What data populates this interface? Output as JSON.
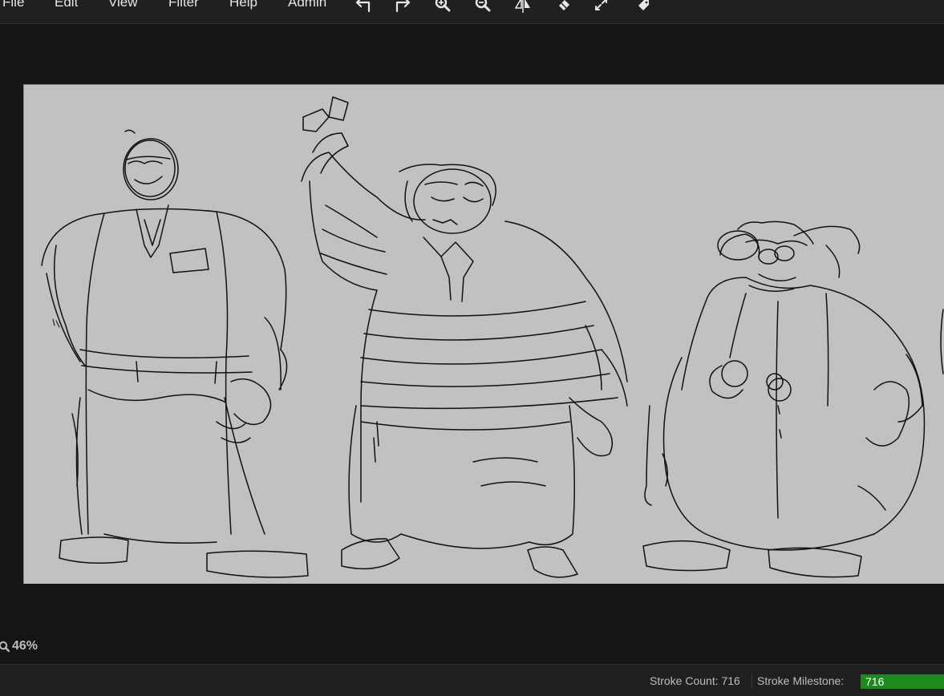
{
  "menu": {
    "items": [
      {
        "label": "File"
      },
      {
        "label": "Edit"
      },
      {
        "label": "View"
      },
      {
        "label": "Filter"
      },
      {
        "label": "Help"
      },
      {
        "label": "Admin"
      }
    ]
  },
  "toolbar": {
    "icons": [
      "undo-icon",
      "redo-icon",
      "zoom-in-icon",
      "zoom-out-icon",
      "flip-icon",
      "eraser-icon",
      "fit-to-screen-icon",
      "tag-icon"
    ]
  },
  "zoom": {
    "value": "46%"
  },
  "status": {
    "stroke_count": "Stroke Count: 716",
    "milestone_label": "Stroke Milestone:",
    "milestone_value": "716",
    "milestone_progress": 1.0
  },
  "colors": {
    "background": "#151515",
    "bars": "#202020",
    "canvas": "#c1c1c1",
    "ink": "#111111",
    "progress_fill": "#1d8a1d"
  }
}
